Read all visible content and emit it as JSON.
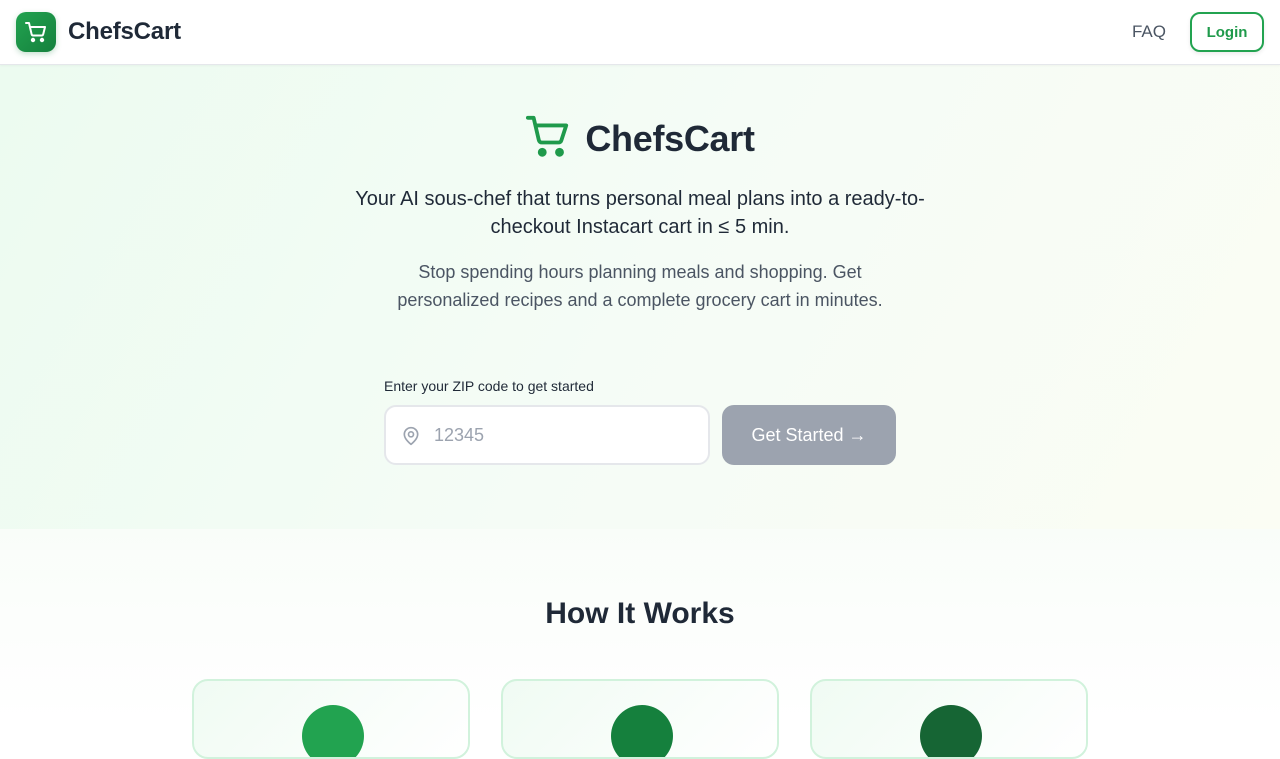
{
  "header": {
    "brand": "ChefsCart",
    "nav_faq": "FAQ",
    "login": "Login"
  },
  "hero": {
    "logo_text": "ChefsCart",
    "tagline": "Your AI sous-chef that turns personal meal plans into a ready-to-checkout Instacart cart in ≤ 5 min.",
    "subtagline": "Stop spending hours planning meals and shopping. Get personalized recipes and a complete grocery cart in minutes.",
    "zip_label": "Enter your ZIP code to get started",
    "zip_placeholder": "12345",
    "zip_value": "",
    "cta": "Get Started →"
  },
  "how_it_works": {
    "title": "How It Works",
    "steps": [
      {
        "color": "#22a350"
      },
      {
        "color": "#15803d"
      },
      {
        "color": "#166534"
      }
    ]
  },
  "colors": {
    "brand_green": "#22a350",
    "brand_green_dark": "#15803d",
    "cta_disabled": "#9ca3af",
    "text_primary": "#1f2937",
    "text_secondary": "#4b5563"
  },
  "icons": {
    "header_logo": "shopping-cart-icon",
    "hero_logo": "shopping-cart-icon",
    "zip_field": "map-pin-icon"
  }
}
